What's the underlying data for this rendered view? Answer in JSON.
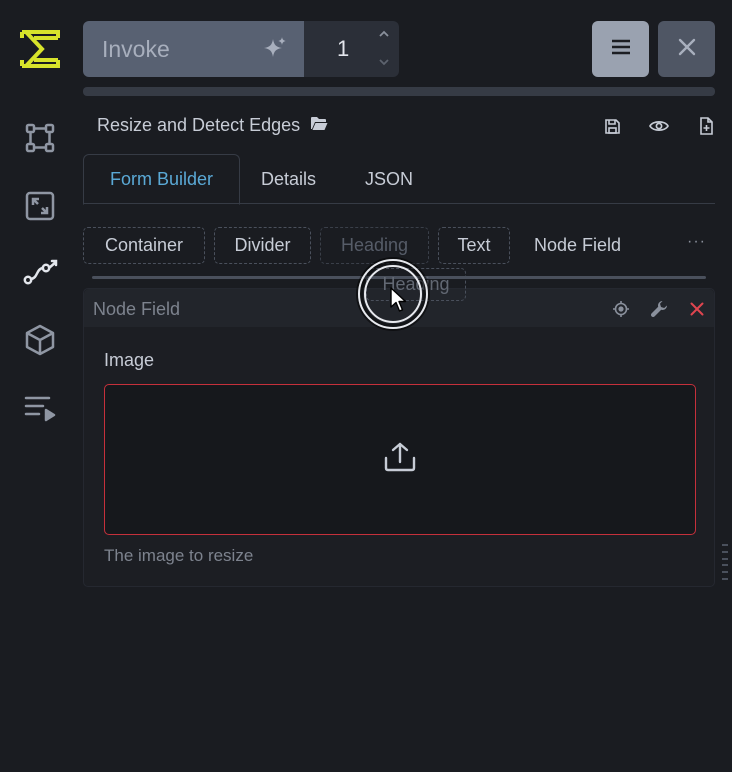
{
  "toolbar": {
    "invoke_label": "Invoke",
    "iterations": "1"
  },
  "workflow": {
    "name": "Resize and Detect Edges"
  },
  "tabs": [
    {
      "label": "Form Builder",
      "active": true
    },
    {
      "label": "Details",
      "active": false
    },
    {
      "label": "JSON",
      "active": false
    }
  ],
  "palette": {
    "container": "Container",
    "divider": "Divider",
    "heading": "Heading",
    "text": "Text",
    "node_field": "Node Field",
    "more": "···"
  },
  "drag_preview": "Heading",
  "node_field": {
    "header": "Node Field",
    "label": "Image",
    "description": "The image to resize"
  },
  "colors": {
    "accent": "#5aa9d6",
    "logo": "#d7e32b",
    "error_border": "#c5303b",
    "remove": "#e0454f"
  }
}
